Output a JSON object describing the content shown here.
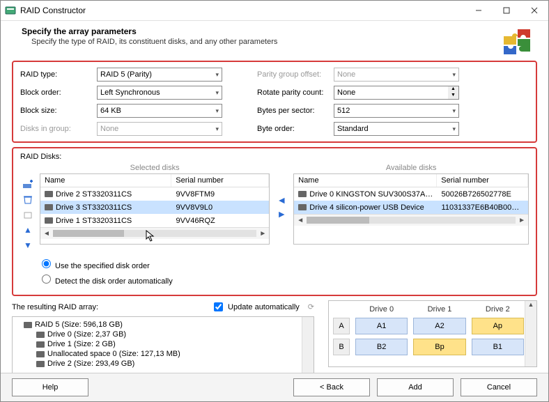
{
  "window": {
    "title": "RAID Constructor"
  },
  "header": {
    "title": "Specify the array parameters",
    "subtitle": "Specify the type of RAID, its constituent disks, and any other parameters"
  },
  "params": {
    "left": {
      "raid_type": {
        "label": "RAID type:",
        "value": "RAID 5 (Parity)"
      },
      "block_order": {
        "label": "Block order:",
        "value": "Left Synchronous"
      },
      "block_size": {
        "label": "Block size:",
        "value": "64 KB"
      },
      "disks_in_group": {
        "label": "Disks in group:",
        "value": "None"
      }
    },
    "right": {
      "parity_offset": {
        "label": "Parity group offset:",
        "value": "None"
      },
      "rotate_parity": {
        "label": "Rotate parity count:",
        "value": "None"
      },
      "bytes_per_sector": {
        "label": "Bytes per sector:",
        "value": "512"
      },
      "byte_order": {
        "label": "Byte order:",
        "value": "Standard"
      }
    }
  },
  "disks_section": {
    "title": "RAID Disks:",
    "selected": {
      "title": "Selected disks",
      "col_name": "Name",
      "col_serial": "Serial number",
      "rows": [
        {
          "name": "Drive 2 ST3320311CS",
          "serial": "9VV8FTM9",
          "sel": false
        },
        {
          "name": "Drive 3 ST3320311CS",
          "serial": "9VV8V9L0",
          "sel": true
        },
        {
          "name": "Drive 1 ST3320311CS",
          "serial": "9VV46RQZ",
          "sel": false
        }
      ]
    },
    "available": {
      "title": "Available disks",
      "col_name": "Name",
      "col_serial": "Serial number",
      "rows": [
        {
          "name": "Drive 0 KINGSTON SUV300S37A240G",
          "serial": "50026B726502778E",
          "sel": false
        },
        {
          "name": "Drive 4 silicon-power USB Device",
          "serial": "11031337E6B40B00B18…",
          "sel": true
        }
      ]
    },
    "radio": {
      "use_specified": "Use the specified disk order",
      "detect_auto": "Detect the disk order automatically"
    }
  },
  "result": {
    "title": "The resulting RAID array:",
    "update_label": "Update automatically",
    "tree": [
      "RAID 5 (Size: 596,18 GB)",
      "Drive 0 (Size: 2,37 GB)",
      "Drive 1 (Size: 2 GB)",
      "Unallocated space 0 (Size: 127,13 MB)",
      "Drive 2 (Size: 293,49 GB)"
    ]
  },
  "stripe": {
    "headers": [
      "Drive 0",
      "Drive 1",
      "Drive 2"
    ],
    "rows": [
      {
        "label": "A",
        "cells": [
          {
            "v": "A1",
            "p": false
          },
          {
            "v": "A2",
            "p": false
          },
          {
            "v": "Ap",
            "p": true
          }
        ]
      },
      {
        "label": "B",
        "cells": [
          {
            "v": "B2",
            "p": false
          },
          {
            "v": "Bp",
            "p": true
          },
          {
            "v": "B1",
            "p": false
          }
        ]
      }
    ]
  },
  "footer": {
    "help": "Help",
    "back": "< Back",
    "add": "Add",
    "cancel": "Cancel"
  }
}
